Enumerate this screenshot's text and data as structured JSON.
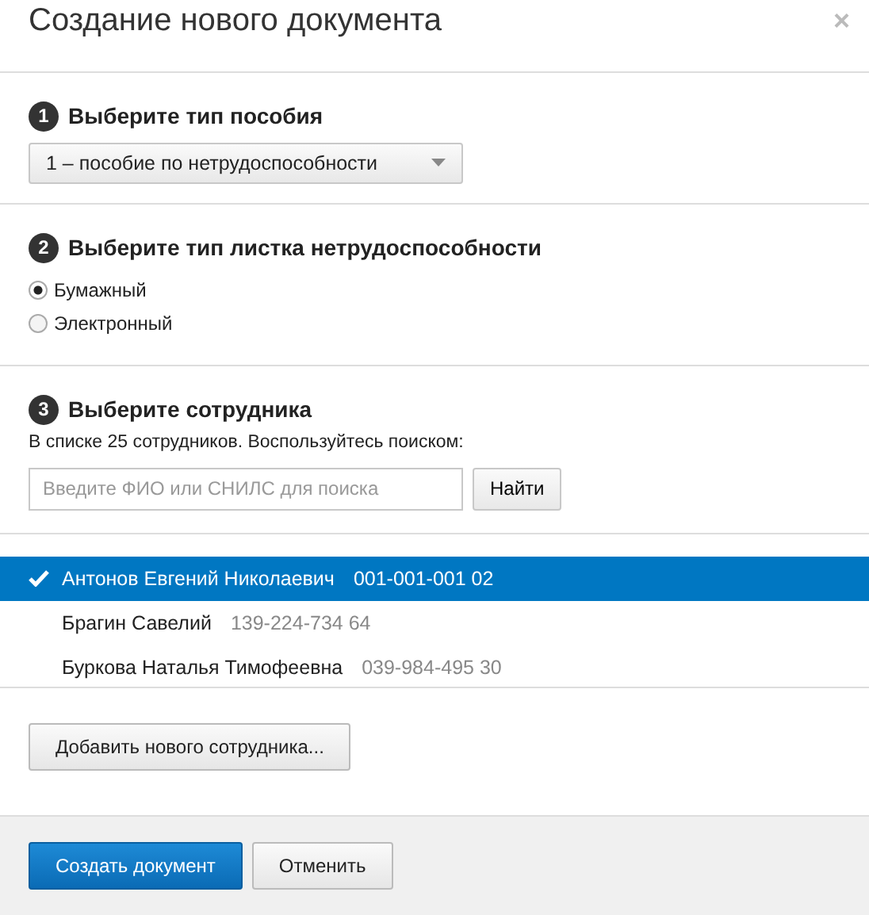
{
  "window": {
    "title": "Создание нового документа",
    "close": "×"
  },
  "step1": {
    "number": "1",
    "title": "Выберите тип пособия",
    "select": "1 – пособие по нетрудоспособности"
  },
  "step2": {
    "number": "2",
    "title": "Выберите тип листка нетрудоспособности",
    "options": [
      {
        "label": "Бумажный",
        "selected": true
      },
      {
        "label": "Электронный",
        "selected": false
      }
    ]
  },
  "step3": {
    "number": "3",
    "title": "Выберите сотрудника",
    "hint": "В списке 25 сотрудников. Воспользуйтесь поиском:",
    "search": {
      "placeholder": "Введите ФИО или СНИЛС для поиска"
    },
    "search_button": "Найти",
    "employees": [
      {
        "name": "Антонов Евгений Николаевич",
        "snils": "001-001-001 02",
        "selected": true
      },
      {
        "name": "Брагин Савелий",
        "snils": "139-224-734 64",
        "selected": false
      },
      {
        "name": "Буркова Наталья Тимофеевна",
        "snils": "039-984-495 30",
        "selected": false
      }
    ],
    "add_button": "Добавить нового сотрудника..."
  },
  "footer": {
    "buttons": [
      {
        "label": "Создать документ",
        "kind": "primary"
      },
      {
        "label": "Отменить",
        "kind": "secondary"
      }
    ]
  }
}
